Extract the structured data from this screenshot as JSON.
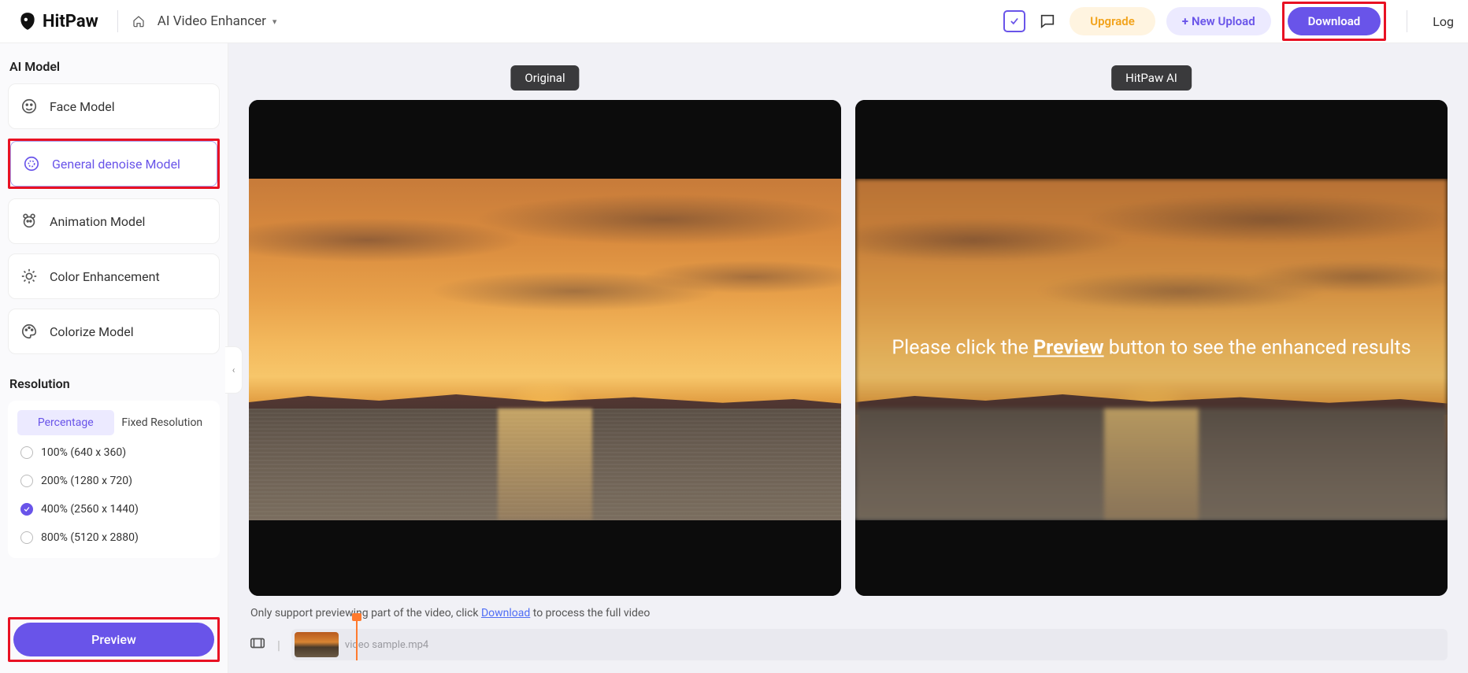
{
  "header": {
    "brand": "HitPaw",
    "title": "AI Video Enhancer",
    "upgrade": "Upgrade",
    "new_upload": "New Upload",
    "download": "Download",
    "login": "Log"
  },
  "sidebar": {
    "ai_model_title": "AI Model",
    "models": [
      {
        "id": "face",
        "label": "Face Model"
      },
      {
        "id": "denoise",
        "label": "General denoise Model",
        "selected": true
      },
      {
        "id": "animation",
        "label": "Animation Model"
      },
      {
        "id": "color",
        "label": "Color Enhancement"
      },
      {
        "id": "colorize",
        "label": "Colorize Model"
      }
    ],
    "resolution_title": "Resolution",
    "tabs": {
      "percentage": "Percentage",
      "fixed": "Fixed Resolution",
      "active": "percentage"
    },
    "options": [
      {
        "label": "100% (640 x 360)",
        "checked": false
      },
      {
        "label": "200% (1280 x 720)",
        "checked": false
      },
      {
        "label": "400% (2560 x 1440)",
        "checked": true
      },
      {
        "label": "800% (5120 x 2880)",
        "checked": false
      }
    ],
    "preview_button": "Preview"
  },
  "compare": {
    "original_label": "Original",
    "ai_label": "HitPaw AI",
    "overlay_pre": "Please click the ",
    "overlay_bold": "Preview",
    "overlay_post": " button to see the enhanced results"
  },
  "note": {
    "pre": "Only support previewing part of the video, click ",
    "link": "Download",
    "post": " to process the full video"
  },
  "timeline": {
    "filename": "video sample.mp4"
  }
}
